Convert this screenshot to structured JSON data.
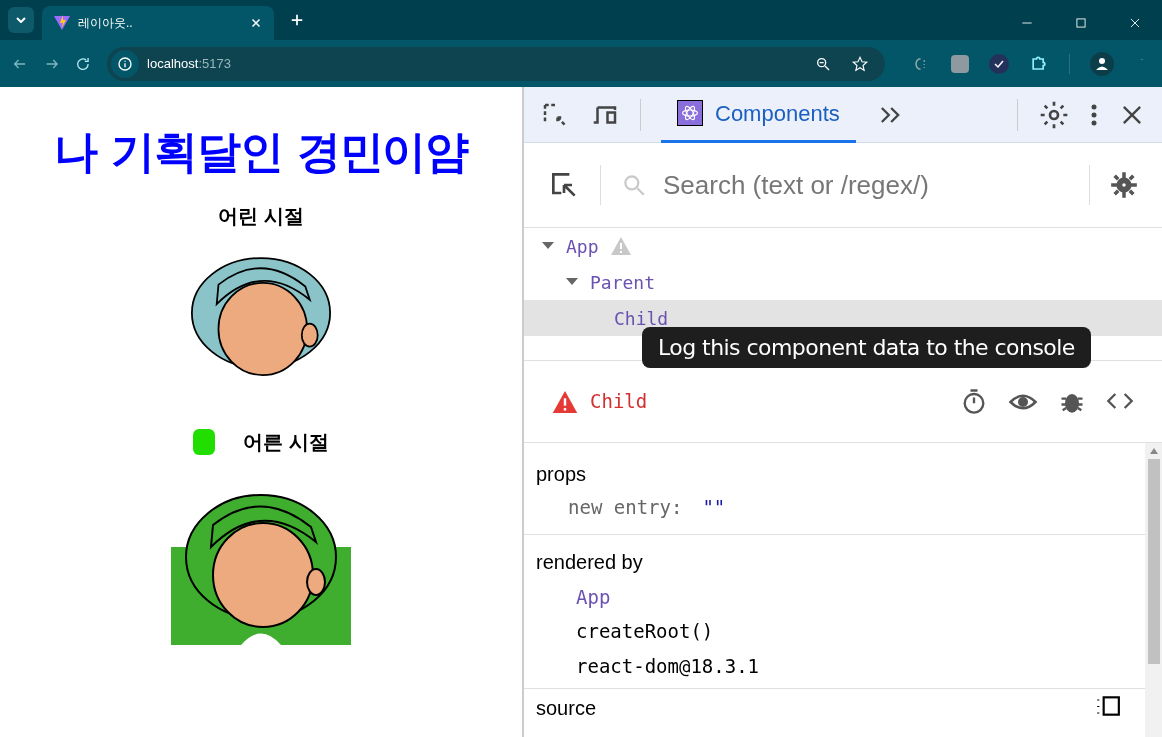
{
  "browser": {
    "tabs": [
      {
        "title": "레이아웃..",
        "selected": true
      }
    ],
    "address": {
      "host": "localhost",
      "port": ":5173"
    }
  },
  "page": {
    "heading": "나 기획달인 경민이얌",
    "sections": [
      {
        "title": "어린 시절",
        "marker": false
      },
      {
        "title": "어른 시절",
        "marker": true
      }
    ]
  },
  "devtools": {
    "tabs": [
      {
        "label": "Components",
        "selected": true
      }
    ],
    "search": {
      "placeholder": "Search (text or /regex/)"
    },
    "tree": [
      {
        "name": "App",
        "expanded": true,
        "warning": true,
        "selected": false,
        "children": [
          {
            "name": "Parent",
            "expanded": true,
            "warning": false,
            "selected": false,
            "children": [
              {
                "name": "Child",
                "warning": false,
                "selected": true
              }
            ]
          }
        ]
      }
    ],
    "tooltip": "Log this component data to the console",
    "inspected": {
      "name": "Child",
      "warning": true
    },
    "props": {
      "title": "props",
      "items": [
        {
          "key": "new entry:",
          "value": "\"\""
        }
      ]
    },
    "rendered_by": {
      "title": "rendered by",
      "items": [
        {
          "text": "App",
          "kind": "component"
        },
        {
          "text": "createRoot()",
          "kind": "plain"
        },
        {
          "text": "react-dom@18.3.1",
          "kind": "plain"
        }
      ]
    },
    "source": {
      "title": "source"
    }
  }
}
